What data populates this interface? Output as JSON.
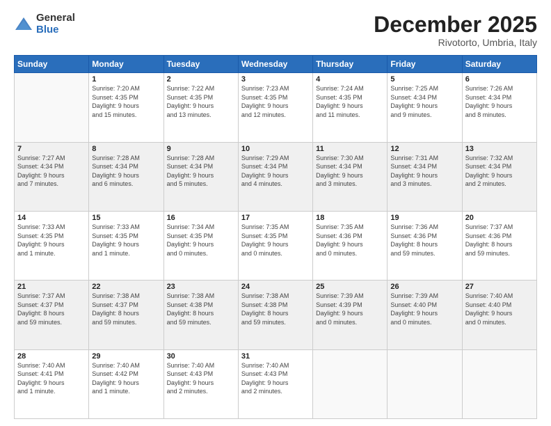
{
  "logo": {
    "general": "General",
    "blue": "Blue"
  },
  "title": "December 2025",
  "location": "Rivotorto, Umbria, Italy",
  "days_of_week": [
    "Sunday",
    "Monday",
    "Tuesday",
    "Wednesday",
    "Thursday",
    "Friday",
    "Saturday"
  ],
  "weeks": [
    [
      {
        "day": "",
        "info": ""
      },
      {
        "day": "1",
        "info": "Sunrise: 7:20 AM\nSunset: 4:35 PM\nDaylight: 9 hours\nand 15 minutes."
      },
      {
        "day": "2",
        "info": "Sunrise: 7:22 AM\nSunset: 4:35 PM\nDaylight: 9 hours\nand 13 minutes."
      },
      {
        "day": "3",
        "info": "Sunrise: 7:23 AM\nSunset: 4:35 PM\nDaylight: 9 hours\nand 12 minutes."
      },
      {
        "day": "4",
        "info": "Sunrise: 7:24 AM\nSunset: 4:35 PM\nDaylight: 9 hours\nand 11 minutes."
      },
      {
        "day": "5",
        "info": "Sunrise: 7:25 AM\nSunset: 4:34 PM\nDaylight: 9 hours\nand 9 minutes."
      },
      {
        "day": "6",
        "info": "Sunrise: 7:26 AM\nSunset: 4:34 PM\nDaylight: 9 hours\nand 8 minutes."
      }
    ],
    [
      {
        "day": "7",
        "info": "Sunrise: 7:27 AM\nSunset: 4:34 PM\nDaylight: 9 hours\nand 7 minutes."
      },
      {
        "day": "8",
        "info": "Sunrise: 7:28 AM\nSunset: 4:34 PM\nDaylight: 9 hours\nand 6 minutes."
      },
      {
        "day": "9",
        "info": "Sunrise: 7:28 AM\nSunset: 4:34 PM\nDaylight: 9 hours\nand 5 minutes."
      },
      {
        "day": "10",
        "info": "Sunrise: 7:29 AM\nSunset: 4:34 PM\nDaylight: 9 hours\nand 4 minutes."
      },
      {
        "day": "11",
        "info": "Sunrise: 7:30 AM\nSunset: 4:34 PM\nDaylight: 9 hours\nand 3 minutes."
      },
      {
        "day": "12",
        "info": "Sunrise: 7:31 AM\nSunset: 4:34 PM\nDaylight: 9 hours\nand 3 minutes."
      },
      {
        "day": "13",
        "info": "Sunrise: 7:32 AM\nSunset: 4:34 PM\nDaylight: 9 hours\nand 2 minutes."
      }
    ],
    [
      {
        "day": "14",
        "info": "Sunrise: 7:33 AM\nSunset: 4:35 PM\nDaylight: 9 hours\nand 1 minute."
      },
      {
        "day": "15",
        "info": "Sunrise: 7:33 AM\nSunset: 4:35 PM\nDaylight: 9 hours\nand 1 minute."
      },
      {
        "day": "16",
        "info": "Sunrise: 7:34 AM\nSunset: 4:35 PM\nDaylight: 9 hours\nand 0 minutes."
      },
      {
        "day": "17",
        "info": "Sunrise: 7:35 AM\nSunset: 4:35 PM\nDaylight: 9 hours\nand 0 minutes."
      },
      {
        "day": "18",
        "info": "Sunrise: 7:35 AM\nSunset: 4:36 PM\nDaylight: 9 hours\nand 0 minutes."
      },
      {
        "day": "19",
        "info": "Sunrise: 7:36 AM\nSunset: 4:36 PM\nDaylight: 8 hours\nand 59 minutes."
      },
      {
        "day": "20",
        "info": "Sunrise: 7:37 AM\nSunset: 4:36 PM\nDaylight: 8 hours\nand 59 minutes."
      }
    ],
    [
      {
        "day": "21",
        "info": "Sunrise: 7:37 AM\nSunset: 4:37 PM\nDaylight: 8 hours\nand 59 minutes."
      },
      {
        "day": "22",
        "info": "Sunrise: 7:38 AM\nSunset: 4:37 PM\nDaylight: 8 hours\nand 59 minutes."
      },
      {
        "day": "23",
        "info": "Sunrise: 7:38 AM\nSunset: 4:38 PM\nDaylight: 8 hours\nand 59 minutes."
      },
      {
        "day": "24",
        "info": "Sunrise: 7:38 AM\nSunset: 4:38 PM\nDaylight: 8 hours\nand 59 minutes."
      },
      {
        "day": "25",
        "info": "Sunrise: 7:39 AM\nSunset: 4:39 PM\nDaylight: 9 hours\nand 0 minutes."
      },
      {
        "day": "26",
        "info": "Sunrise: 7:39 AM\nSunset: 4:40 PM\nDaylight: 9 hours\nand 0 minutes."
      },
      {
        "day": "27",
        "info": "Sunrise: 7:40 AM\nSunset: 4:40 PM\nDaylight: 9 hours\nand 0 minutes."
      }
    ],
    [
      {
        "day": "28",
        "info": "Sunrise: 7:40 AM\nSunset: 4:41 PM\nDaylight: 9 hours\nand 1 minute."
      },
      {
        "day": "29",
        "info": "Sunrise: 7:40 AM\nSunset: 4:42 PM\nDaylight: 9 hours\nand 1 minute."
      },
      {
        "day": "30",
        "info": "Sunrise: 7:40 AM\nSunset: 4:43 PM\nDaylight: 9 hours\nand 2 minutes."
      },
      {
        "day": "31",
        "info": "Sunrise: 7:40 AM\nSunset: 4:43 PM\nDaylight: 9 hours\nand 2 minutes."
      },
      {
        "day": "",
        "info": ""
      },
      {
        "day": "",
        "info": ""
      },
      {
        "day": "",
        "info": ""
      }
    ]
  ]
}
